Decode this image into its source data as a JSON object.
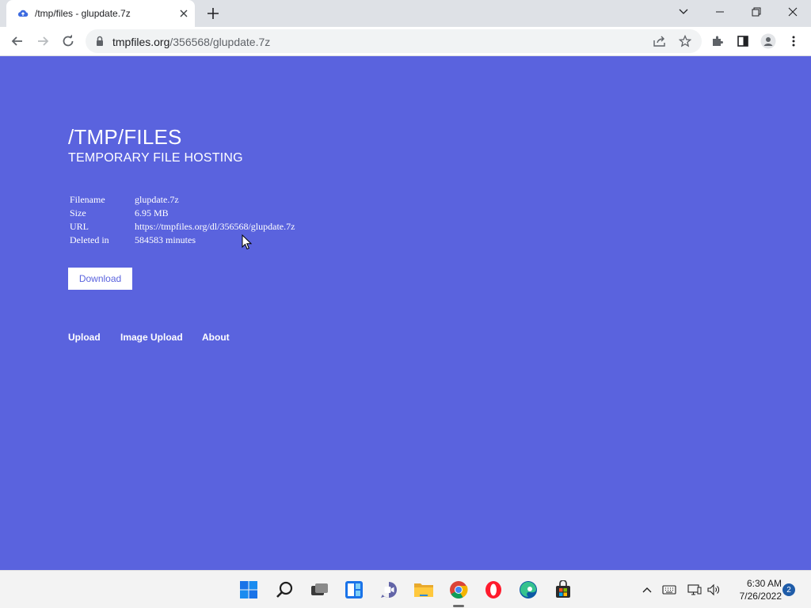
{
  "browser": {
    "tab_title": "/tmp/files - glupdate.7z",
    "url_domain": "tmpfiles.org",
    "url_path": "/356568/glupdate.7z"
  },
  "page": {
    "title": "/TMP/FILES",
    "subtitle": "TEMPORARY FILE HOSTING",
    "info": {
      "filename_label": "Filename",
      "filename_value": "glupdate.7z",
      "size_label": "Size",
      "size_value": "6.95 MB",
      "url_label": "URL",
      "url_value": "https://tmpfiles.org/dl/356568/glupdate.7z",
      "deleted_label": "Deleted in",
      "deleted_value": "584583 minutes"
    },
    "download_label": "Download",
    "nav": {
      "upload": "Upload",
      "image_upload": "Image Upload",
      "about": "About"
    }
  },
  "taskbar": {
    "time": "6:30 AM",
    "date": "7/26/2022",
    "notification_count": "2"
  },
  "colors": {
    "page_background": "#5a63de",
    "accent_text": "#5a63de"
  }
}
